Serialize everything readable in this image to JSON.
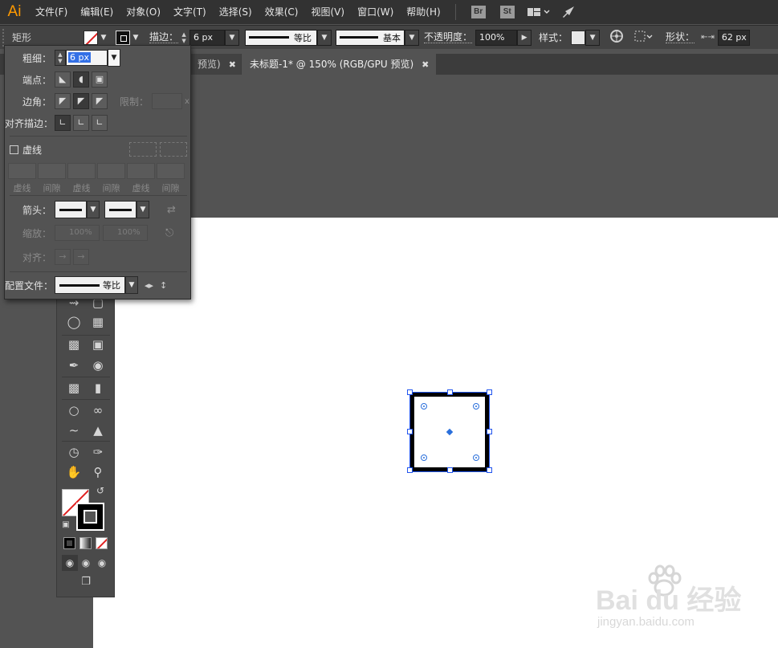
{
  "app": {
    "logo": "Ai"
  },
  "menu": {
    "items": [
      "文件(F)",
      "编辑(E)",
      "对象(O)",
      "文字(T)",
      "选择(S)",
      "效果(C)",
      "视图(V)",
      "窗口(W)",
      "帮助(H)"
    ],
    "bridge_label": "Br",
    "stock_label": "St"
  },
  "control": {
    "shape_label": "矩形",
    "stroke_label": "描边：",
    "stroke_value": "6 px",
    "profile_label": "等比",
    "brush_label": "基本",
    "opacity_label": "不透明度：",
    "opacity_value": "100%",
    "style_label": "样式：",
    "shape_prop_label": "形状：",
    "width_value": "62 px"
  },
  "tabs": [
    {
      "label": "预览)"
    },
    {
      "label": "未标题-1* @ 150% (RGB/GPU 预览)",
      "active": true
    }
  ],
  "stroke_panel": {
    "weight_label": "粗细：",
    "weight_value": "6 px",
    "cap_label": "端点：",
    "corner_label": "边角：",
    "limit_label": "限制：",
    "limit_suffix": "x",
    "align_label": "对齐描边：",
    "dashed_label": "虚线",
    "dash_labels": [
      "虚线",
      "间隙",
      "虚线",
      "间隙",
      "虚线",
      "间隙"
    ],
    "arrow_label": "箭头：",
    "scale_label": "缩放：",
    "scale_values": [
      "100%",
      "100%"
    ],
    "align_arrow_label": "对齐：",
    "profile_label": "配置文件：",
    "profile_value": "等比"
  },
  "watermark": {
    "main": "Bai du 经验",
    "sub": "jingyan.baidu.com"
  },
  "colors": {
    "menubar": "#323232",
    "controlbar": "#434343",
    "panel": "#535353",
    "selection": "#2255ee",
    "logo": "#ff9a00"
  }
}
